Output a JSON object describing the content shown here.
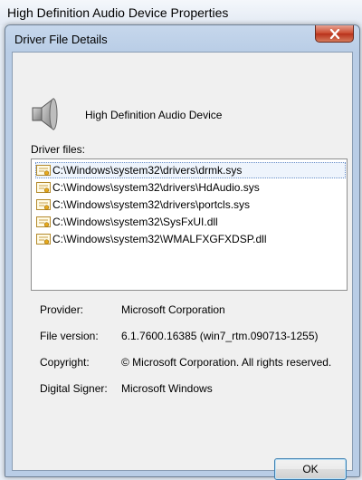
{
  "parent_window": {
    "title": "High Definition Audio Device Properties"
  },
  "dialog": {
    "title": "Driver File Details",
    "device_name": "High Definition Audio Device",
    "driver_files_label": "Driver files:",
    "driver_files": [
      "C:\\Windows\\system32\\drivers\\drmk.sys",
      "C:\\Windows\\system32\\drivers\\HdAudio.sys",
      "C:\\Windows\\system32\\drivers\\portcls.sys",
      "C:\\Windows\\system32\\SysFxUI.dll",
      "C:\\Windows\\system32\\WMALFXGFXDSP.dll"
    ],
    "selected_file_index": 0,
    "info": {
      "provider_label": "Provider:",
      "provider_value": "Microsoft Corporation",
      "file_version_label": "File version:",
      "file_version_value": "6.1.7600.16385 (win7_rtm.090713-1255)",
      "copyright_label": "Copyright:",
      "copyright_value": "© Microsoft Corporation. All rights reserved.",
      "digital_signer_label": "Digital Signer:",
      "digital_signer_value": "Microsoft Windows"
    },
    "ok_label": "OK"
  },
  "icons": {
    "close": "close-icon",
    "device": "speaker-icon",
    "file": "certificate-file-icon"
  },
  "colors": {
    "close_button": "#c9482c",
    "selection_border": "#6a8fc9",
    "client_bg": "#f0f0f0"
  }
}
